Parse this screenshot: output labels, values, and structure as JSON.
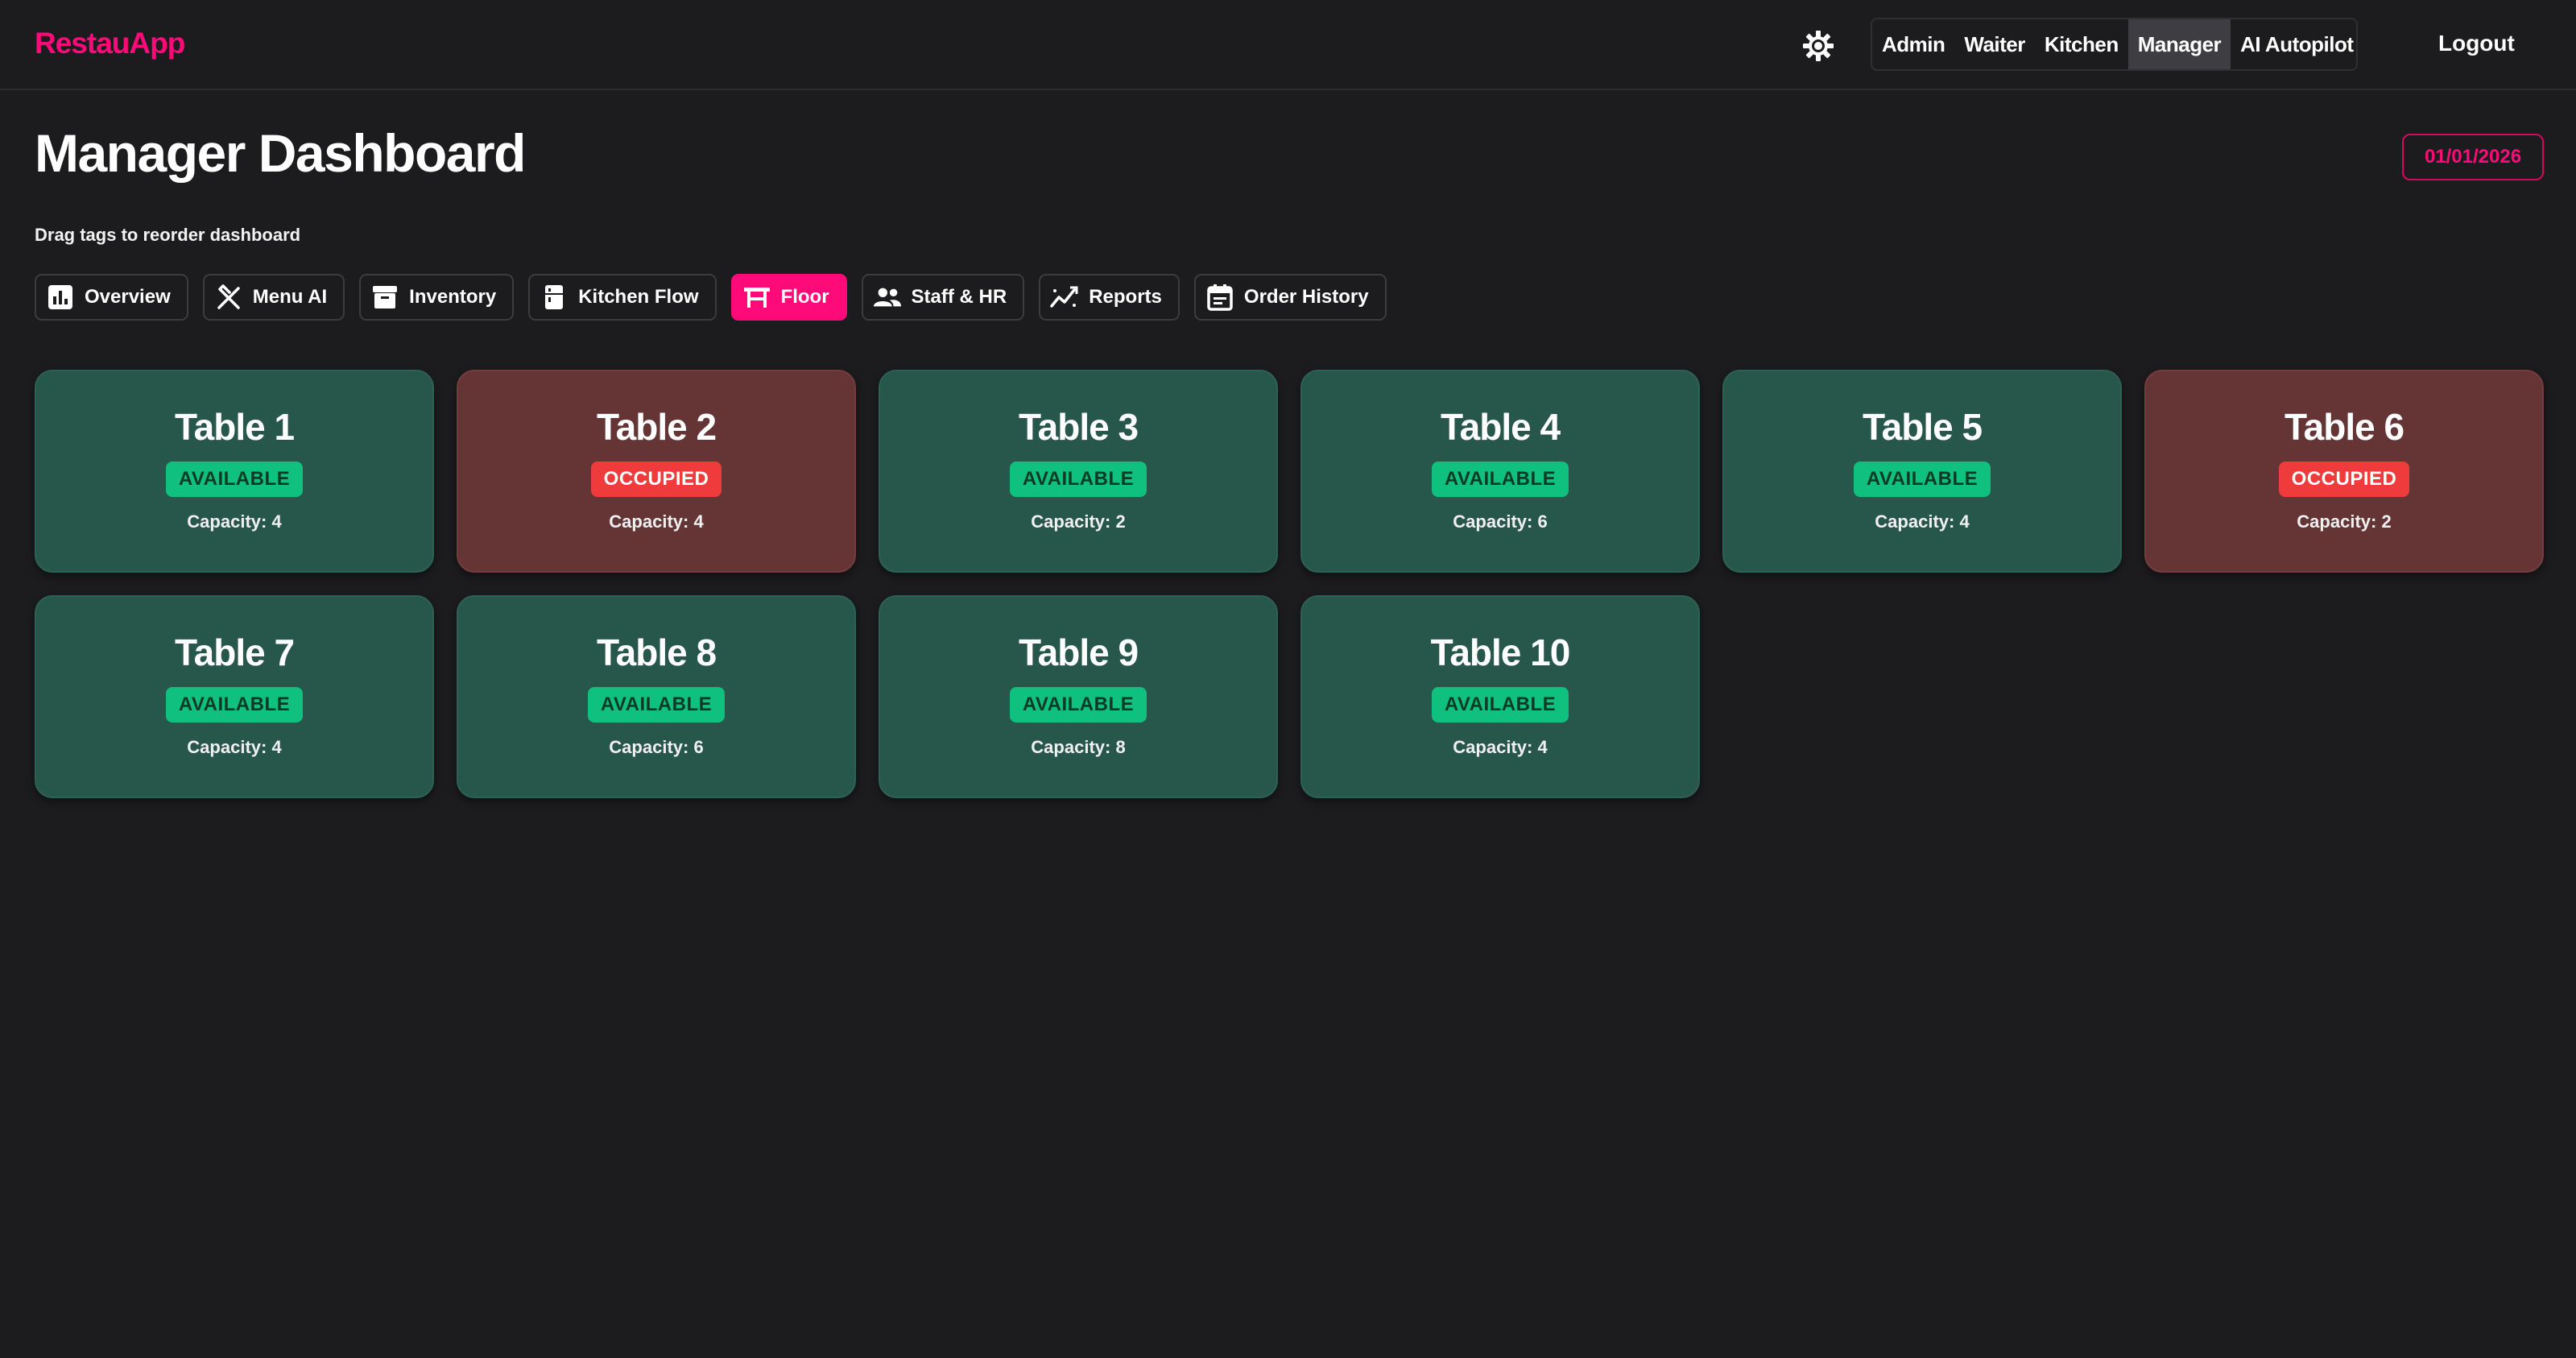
{
  "app": {
    "brand": "RestauApp"
  },
  "nav": {
    "theme_icon": "sun-gear-icon",
    "roles": [
      {
        "label": "Admin",
        "active": false
      },
      {
        "label": "Waiter",
        "active": false
      },
      {
        "label": "Kitchen",
        "active": false
      },
      {
        "label": "Manager",
        "active": true
      },
      {
        "label": "AI Autopilot",
        "active": false
      }
    ],
    "logout_label": "Logout"
  },
  "header": {
    "title": "Manager Dashboard",
    "date": "01/01/2026",
    "hint": "Drag tags to reorder dashboard"
  },
  "tabs": [
    {
      "label": "Overview",
      "icon": "bar-chart-icon",
      "active": false
    },
    {
      "label": "Menu AI",
      "icon": "fork-knife-icon",
      "active": false
    },
    {
      "label": "Inventory",
      "icon": "archive-box-icon",
      "active": false
    },
    {
      "label": "Kitchen Flow",
      "icon": "fridge-icon",
      "active": false
    },
    {
      "label": "Floor",
      "icon": "table-chairs-icon",
      "active": true
    },
    {
      "label": "Staff & HR",
      "icon": "people-icon",
      "active": false
    },
    {
      "label": "Reports",
      "icon": "trend-line-icon",
      "active": false
    },
    {
      "label": "Order History",
      "icon": "calendar-list-icon",
      "active": false
    }
  ],
  "tables": [
    {
      "name": "Table 1",
      "status": "AVAILABLE",
      "capacity": "Capacity: 4",
      "state": "available"
    },
    {
      "name": "Table 2",
      "status": "OCCUPIED",
      "capacity": "Capacity: 4",
      "state": "occupied"
    },
    {
      "name": "Table 3",
      "status": "AVAILABLE",
      "capacity": "Capacity: 2",
      "state": "available"
    },
    {
      "name": "Table 4",
      "status": "AVAILABLE",
      "capacity": "Capacity: 6",
      "state": "available"
    },
    {
      "name": "Table 5",
      "status": "AVAILABLE",
      "capacity": "Capacity: 4",
      "state": "available"
    },
    {
      "name": "Table 6",
      "status": "OCCUPIED",
      "capacity": "Capacity: 2",
      "state": "occupied"
    },
    {
      "name": "Table 7",
      "status": "AVAILABLE",
      "capacity": "Capacity: 4",
      "state": "available"
    },
    {
      "name": "Table 8",
      "status": "AVAILABLE",
      "capacity": "Capacity: 6",
      "state": "available"
    },
    {
      "name": "Table 9",
      "status": "AVAILABLE",
      "capacity": "Capacity: 8",
      "state": "available"
    },
    {
      "name": "Table 10",
      "status": "AVAILABLE",
      "capacity": "Capacity: 4",
      "state": "available"
    }
  ],
  "colors": {
    "brand": "#ff0a78",
    "background": "#1c1c1e",
    "available_card": "#27564a",
    "occupied_card": "#653536",
    "available_badge": "#10c07e",
    "occupied_badge": "#ef3b3b"
  }
}
